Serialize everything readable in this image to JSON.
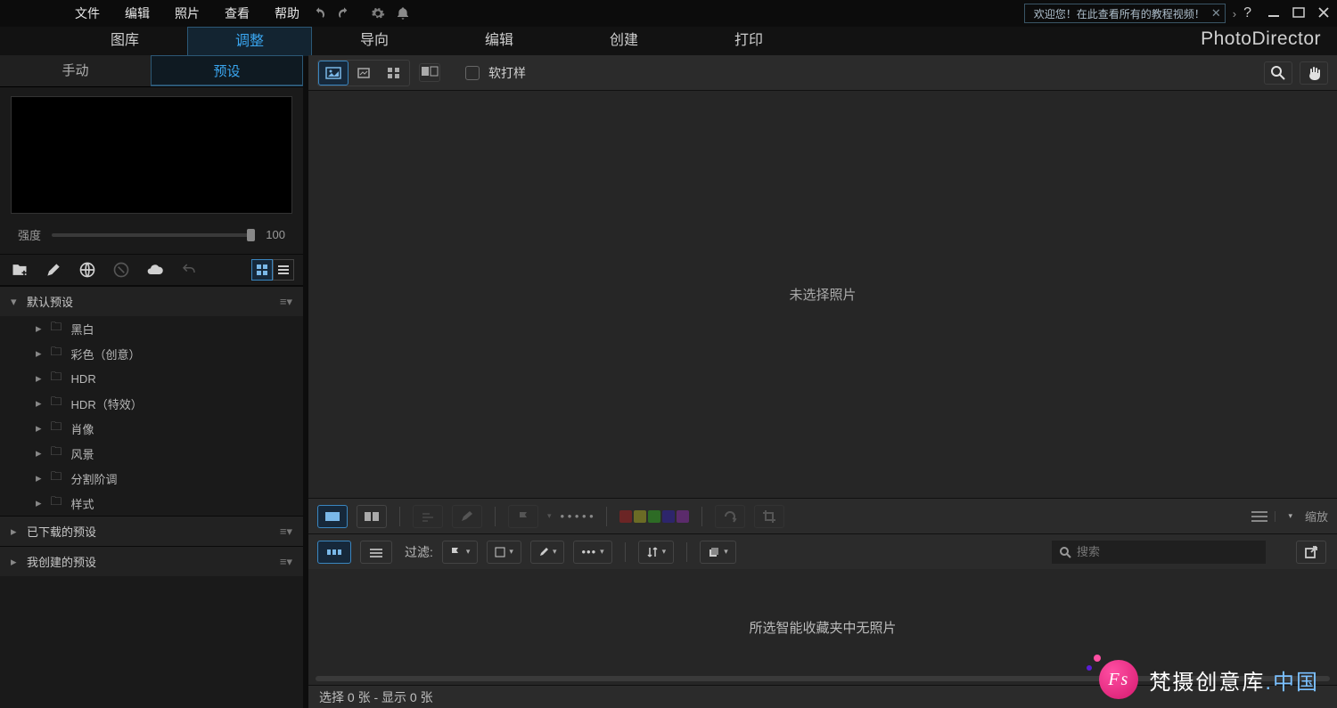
{
  "menu": {
    "file": "文件",
    "edit": "编辑",
    "photo": "照片",
    "view": "查看",
    "help": "帮助"
  },
  "welcome": "欢迎您！在此查看所有的教程视频！",
  "help_glyph": "?",
  "modules": {
    "library": "图库",
    "adjust": "调整",
    "guided": "导向",
    "edit": "编辑",
    "create": "创建",
    "print": "打印"
  },
  "app_title": "PhotoDirector",
  "subtabs": {
    "manual": "手动",
    "preset": "预设"
  },
  "intensity_label": "强度",
  "intensity_value": "100",
  "sections": {
    "default": "默认预设",
    "downloaded": "已下载的预设",
    "created": "我创建的预设"
  },
  "presets": [
    "黑白",
    "彩色（创意）",
    "HDR",
    "HDR（特效）",
    "肖像",
    "风景",
    "分割阶调",
    "样式"
  ],
  "soft_proof": "软打样",
  "canvas_msg": "未选择照片",
  "zoom_label": "缩放",
  "filter_label": "过滤:",
  "search_placeholder": "搜索",
  "thumb_msg": "所选智能收藏夹中无照片",
  "status": "选择 0 张 - 显示 0 张",
  "color_chips": [
    "#6b2525",
    "#6b6b25",
    "#2d6b25",
    "#2d256b",
    "#5b2b6b"
  ],
  "watermark": {
    "badge": "Fs",
    "text": "梵摄创意库",
    "suffix": ".中国"
  }
}
